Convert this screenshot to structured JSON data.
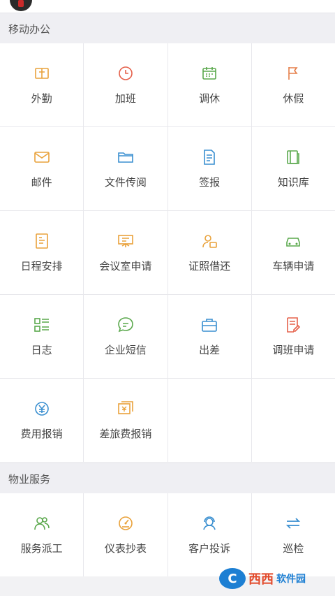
{
  "sections": [
    {
      "title": "移动办公",
      "items": [
        {
          "label": "外勤",
          "icon": "field-work-icon",
          "color": "#e9a23b"
        },
        {
          "label": "加班",
          "icon": "clock-icon",
          "color": "#e5604a"
        },
        {
          "label": "调休",
          "icon": "calendar-icon",
          "color": "#5aa84c"
        },
        {
          "label": "休假",
          "icon": "flag-icon",
          "color": "#e57f4a"
        },
        {
          "label": "邮件",
          "icon": "mail-icon",
          "color": "#e9a23b"
        },
        {
          "label": "文件传阅",
          "icon": "folder-icon",
          "color": "#3a8fd0"
        },
        {
          "label": "签报",
          "icon": "document-icon",
          "color": "#3a8fd0"
        },
        {
          "label": "知识库",
          "icon": "book-icon",
          "color": "#5aa84c"
        },
        {
          "label": "日程安排",
          "icon": "schedule-icon",
          "color": "#e9a23b"
        },
        {
          "label": "会议室申请",
          "icon": "presentation-icon",
          "color": "#e9a23b"
        },
        {
          "label": "证照借还",
          "icon": "id-card-icon",
          "color": "#e9a23b"
        },
        {
          "label": "车辆申请",
          "icon": "car-icon",
          "color": "#5aa84c"
        },
        {
          "label": "日志",
          "icon": "log-list-icon",
          "color": "#5aa84c"
        },
        {
          "label": "企业短信",
          "icon": "chat-icon",
          "color": "#5aa84c"
        },
        {
          "label": "出差",
          "icon": "briefcase-icon",
          "color": "#3a8fd0"
        },
        {
          "label": "调班申请",
          "icon": "shift-edit-icon",
          "color": "#e5604a"
        },
        {
          "label": "费用报销",
          "icon": "yuan-circle-icon",
          "color": "#3a8fd0"
        },
        {
          "label": "差旅费报销",
          "icon": "travel-expense-icon",
          "color": "#e9a23b"
        }
      ]
    },
    {
      "title": "物业服务",
      "items": [
        {
          "label": "服务派工",
          "icon": "team-icon",
          "color": "#5aa84c"
        },
        {
          "label": "仪表抄表",
          "icon": "meter-icon",
          "color": "#e9a23b"
        },
        {
          "label": "客户投诉",
          "icon": "customer-service-icon",
          "color": "#3a8fd0"
        },
        {
          "label": "巡检",
          "icon": "exchange-icon",
          "color": "#3a8fd0"
        }
      ]
    }
  ],
  "watermark": {
    "main": "西西",
    "sub": "软件园"
  }
}
